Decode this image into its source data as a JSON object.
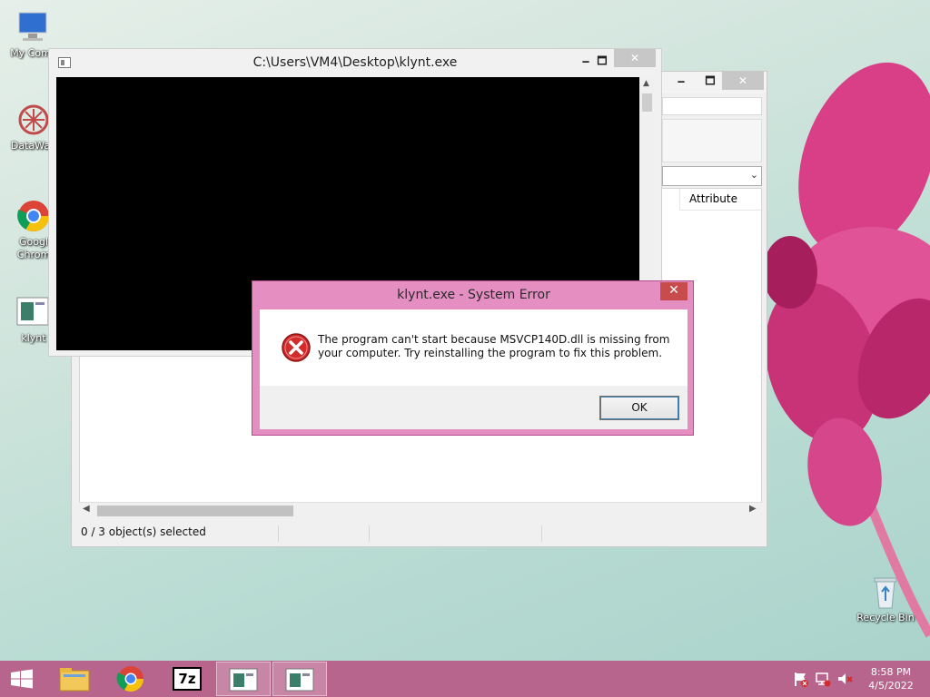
{
  "desktop": {
    "icons": [
      {
        "label": "My Comp"
      },
      {
        "label": "DataWag"
      },
      {
        "label": "Googl Chrom"
      },
      {
        "label": "klynt"
      },
      {
        "label": "Recycle Bin"
      }
    ]
  },
  "explorer": {
    "column_header": "Attribute",
    "status_text": "0 / 3 object(s) selected",
    "minimize": "🗕",
    "maximize": "🗖",
    "close": "✕"
  },
  "console": {
    "title": "C:\\Users\\VM4\\Desktop\\klynt.exe",
    "minimize": "🗕",
    "maximize": "🗖",
    "close": "✕"
  },
  "dialog": {
    "title": "klynt.exe - System Error",
    "message": "The program can't start because MSVCP140D.dll is missing from your computer. Try reinstalling the program to fix this problem.",
    "ok_label": "OK",
    "close": "✕"
  },
  "taskbar": {
    "items": [
      "start-icon",
      "file-explorer-icon",
      "chrome-icon",
      "7zip-icon",
      "app-window-icon",
      "app-window-icon"
    ],
    "sevenzip_label": "7z",
    "clock": {
      "time": "8:58 PM",
      "date": "4/5/2022"
    }
  },
  "colors": {
    "dialog_frame": "#e48ec2",
    "taskbar": "#b8658e",
    "error_red": "#d12b2b"
  }
}
